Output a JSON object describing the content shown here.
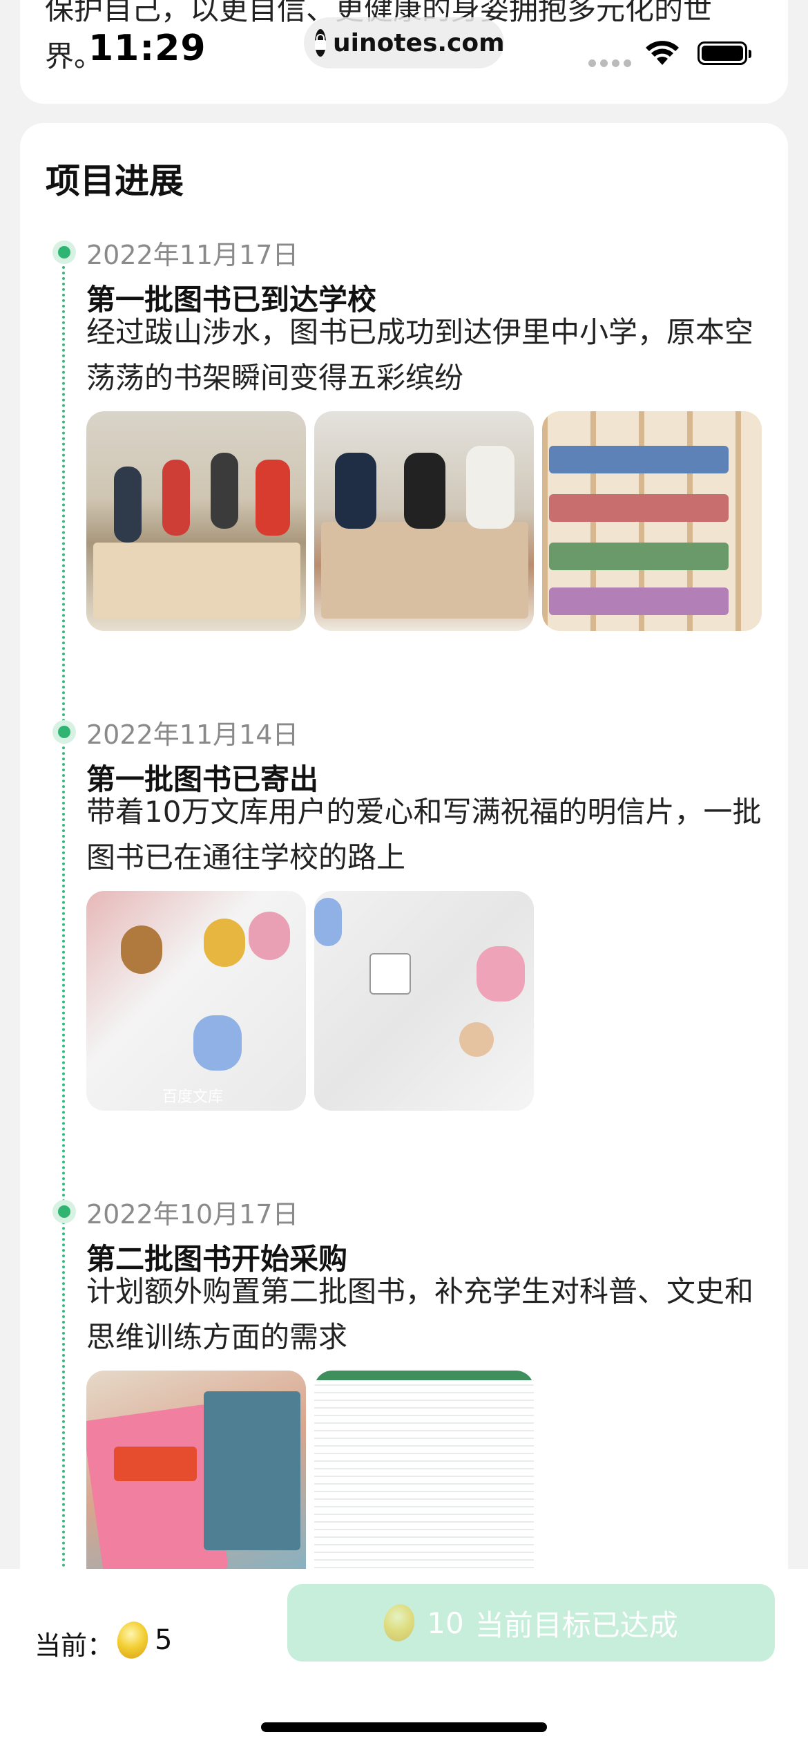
{
  "top_card": {
    "text": "保护自己，以更自信、更健康的身姿拥抱多元化的世界。"
  },
  "status_bar": {
    "time": "11:29",
    "url": "uinotes.com"
  },
  "section": {
    "title": "项目进展"
  },
  "entries": [
    {
      "date": "2022年11月17日",
      "title": "第一批图书已到达学校",
      "desc": "经过跋山涉水，图书已成功到达伊里中小学，原本空荡荡的书架瞬间变得五彩缤纷"
    },
    {
      "date": "2022年11月14日",
      "title": "第一批图书已寄出",
      "desc": "带着10万文库用户的爱心和写满祝福的明信片，一批图书已在通往学校的路上",
      "photo_caption": "百度文库"
    },
    {
      "date": "2022年10月17日",
      "title": "第二批图书开始采购",
      "desc": "计划额外购置第二批图书，补充学生对科普、文史和思维训练方面的需求"
    }
  ],
  "bottom_bar": {
    "current_label": "当前：",
    "current_count": "5",
    "goal_count": "10",
    "goal_text": "当前目标已达成"
  },
  "colors": {
    "accent_green": "#2fb571",
    "button_bg": "#c6eedb"
  }
}
